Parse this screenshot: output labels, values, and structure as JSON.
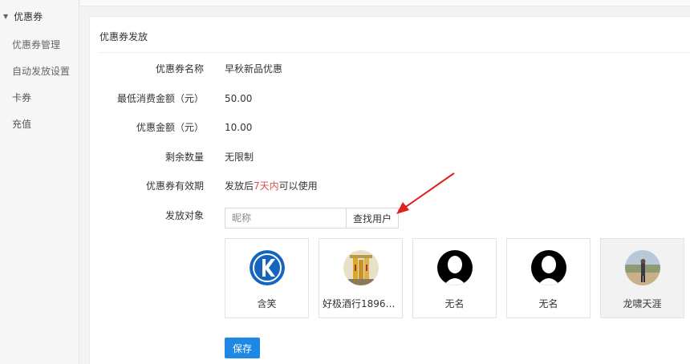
{
  "sidebar": {
    "group_label": "优惠券",
    "items": [
      {
        "label": "优惠券管理"
      },
      {
        "label": "自动发放设置"
      },
      {
        "label": "卡券"
      },
      {
        "label": "充值"
      }
    ]
  },
  "panel": {
    "title": "优惠券发放"
  },
  "form": {
    "name_label": "优惠券名称",
    "name_value": "早秋新品优惠",
    "min_label": "最低消费金额（元）",
    "min_value": "50.00",
    "discount_label": "优惠金额（元）",
    "discount_value": "10.00",
    "remain_label": "剩余数量",
    "remain_value": "无限制",
    "validity_label": "优惠券有效期",
    "validity_prefix": "发放后",
    "validity_highlight": "7天内",
    "validity_suffix": "可以使用",
    "target_label": "发放对象",
    "search_placeholder": "昵称",
    "search_button": "查找用户"
  },
  "users": [
    {
      "name": "含笑",
      "avatar": "k-logo-icon"
    },
    {
      "name": "好极酒行189610...",
      "avatar": "liquor-bottles-photo"
    },
    {
      "name": "无名",
      "avatar": "default-user-icon"
    },
    {
      "name": "无名",
      "avatar": "default-user-icon"
    },
    {
      "name": "龙啸天涯",
      "avatar": "outdoor-person-photo",
      "selected": true
    }
  ],
  "save_label": "保存",
  "colors": {
    "accent": "#1e88e5",
    "highlight": "#d9534f",
    "arrow": "#e02020"
  }
}
